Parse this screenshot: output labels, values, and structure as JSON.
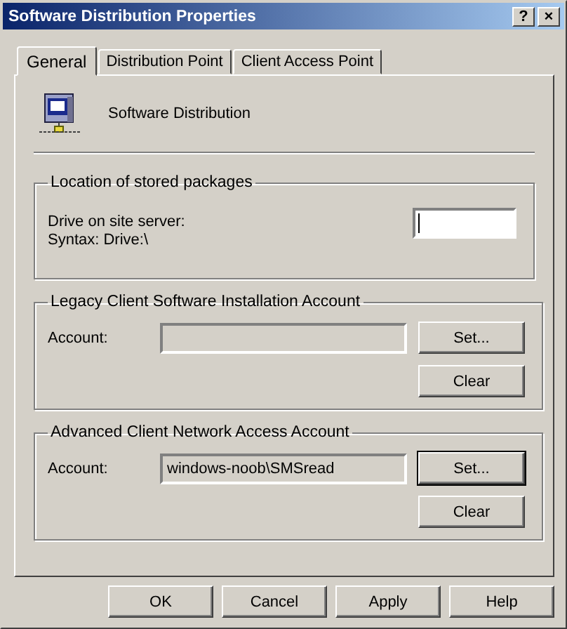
{
  "window": {
    "title": "Software Distribution Properties",
    "controls": [
      "?",
      "×"
    ]
  },
  "tabs": [
    {
      "label": "General",
      "selected": true
    },
    {
      "label": "Distribution Point",
      "selected": false
    },
    {
      "label": "Client Access Point",
      "selected": false
    }
  ],
  "header": {
    "title": "Software Distribution"
  },
  "groups": [
    {
      "kind": "location",
      "title": "Location of stored packages",
      "lines": [
        "Drive on site server:",
        "Syntax: Drive:\\"
      ],
      "field": {
        "focused": true,
        "disabled": false
      }
    },
    {
      "kind": "account",
      "title": "Legacy Client Software Installation Account",
      "label": "Account:",
      "field": {
        "disabled": true
      },
      "buttons": [
        {
          "label": "Set...",
          "focused": false
        },
        {
          "label": "Clear",
          "focused": false
        }
      ]
    },
    {
      "kind": "account",
      "title": "Advanced Client Network Access Account",
      "label": "Account:",
      "field": {
        "value": "windows-noob\\SMSread",
        "disabled": true
      },
      "buttons": [
        {
          "label": "Set...",
          "focused": true
        },
        {
          "label": "Clear",
          "focused": false
        }
      ]
    }
  ],
  "buttons": [
    "OK",
    "Cancel",
    "Apply",
    "Help"
  ]
}
